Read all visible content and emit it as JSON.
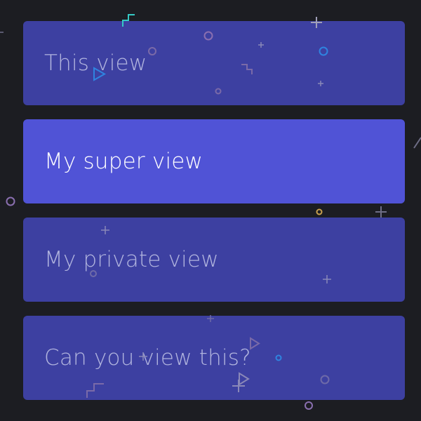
{
  "views": [
    {
      "label": "This view",
      "selected": false
    },
    {
      "label": "My super view",
      "selected": true
    },
    {
      "label": "My private view",
      "selected": false
    },
    {
      "label": "Can you view this?",
      "selected": false
    }
  ],
  "colors": {
    "background": "#1c1d22",
    "item": "#3d40a1",
    "item_selected": "#5053d6",
    "label": "#b1b4de",
    "label_selected": "#ffffff",
    "confetti_purple": "#8a6fb0",
    "confetti_blue": "#2f84e0",
    "confetti_gold": "#c8a04e",
    "confetti_teal": "#35c9c4"
  },
  "decorations": [
    "confetti-circle-icon",
    "confetti-plus-icon",
    "confetti-triangle-icon",
    "confetti-step-icon"
  ]
}
